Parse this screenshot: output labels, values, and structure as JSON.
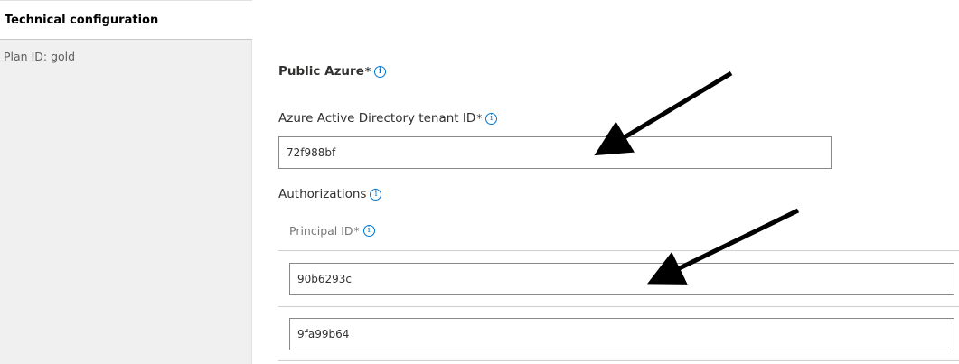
{
  "sidebar": {
    "selected_item": "Technical configuration",
    "items": [
      "Plan ID: gold"
    ]
  },
  "main": {
    "public_azure": {
      "label": "Public Azure",
      "required": "*"
    },
    "tenant": {
      "label": "Azure Active Directory tenant ID",
      "required": "*",
      "value": "72f988bf"
    },
    "authorizations": {
      "label": "Authorizations",
      "principal_label": "Principal ID",
      "required": "*",
      "principal_values": [
        "90b6293c",
        "9fa99b64"
      ]
    }
  },
  "colors": {
    "accent": "#0078d4",
    "sidebar_bg": "#f0f0f0",
    "arrow": "#000000"
  },
  "icons": [
    "info-icon"
  ]
}
